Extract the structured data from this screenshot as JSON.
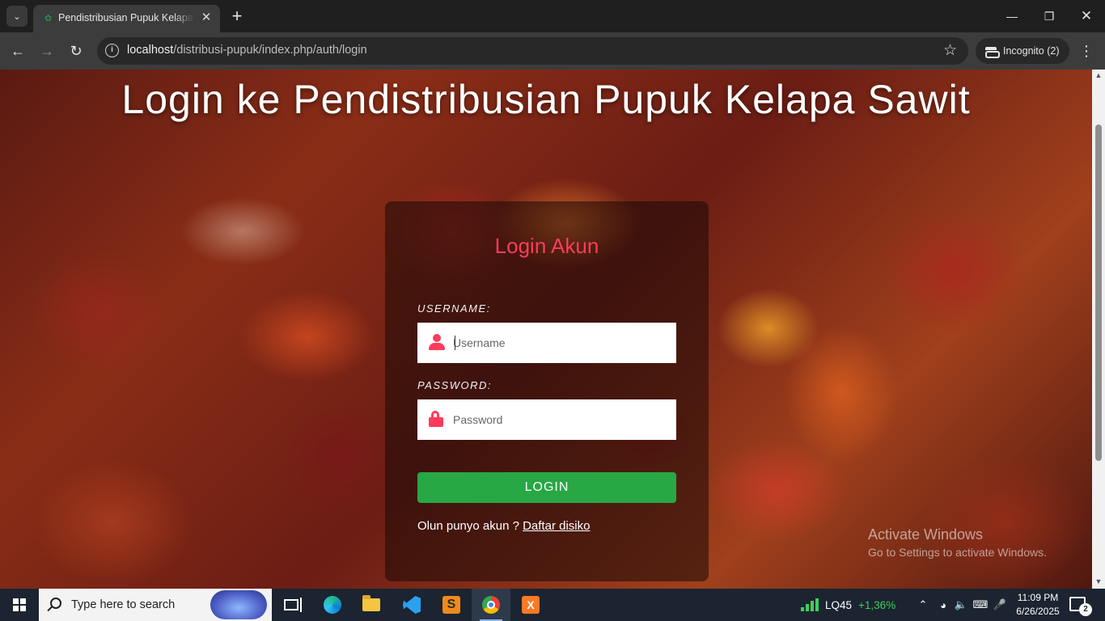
{
  "browser": {
    "tab_title": "Pendistribusian Pupuk Kelapa Sawit",
    "url_host": "localhost",
    "url_path": "/distribusi-pupuk/index.php/auth/login",
    "incognito_label": "Incognito (2)"
  },
  "page": {
    "title": "Login ke Pendistribusian Pupuk Kelapa Sawit",
    "card_title": "Login Akun",
    "username_label": "USERNAME:",
    "username_placeholder": "Username",
    "password_label": "PASSWORD:",
    "password_placeholder": "Password",
    "login_button": "LOGIN",
    "register_prompt": "Olun punyo akun ? ",
    "register_link": "Daftar disiko",
    "accent_color": "#ff3b5c",
    "button_color": "#28a745"
  },
  "watermark": {
    "line1": "Activate Windows",
    "line2": "Go to Settings to activate Windows."
  },
  "taskbar": {
    "search_placeholder": "Type here to search",
    "stock_name": "LQ45",
    "stock_change": "+1,36%",
    "time": "11:09 PM",
    "date": "6/26/2025",
    "notification_count": "2",
    "apps": [
      "task-view",
      "edge",
      "file-explorer",
      "vscode",
      "sublime-text",
      "chrome",
      "xampp"
    ]
  }
}
